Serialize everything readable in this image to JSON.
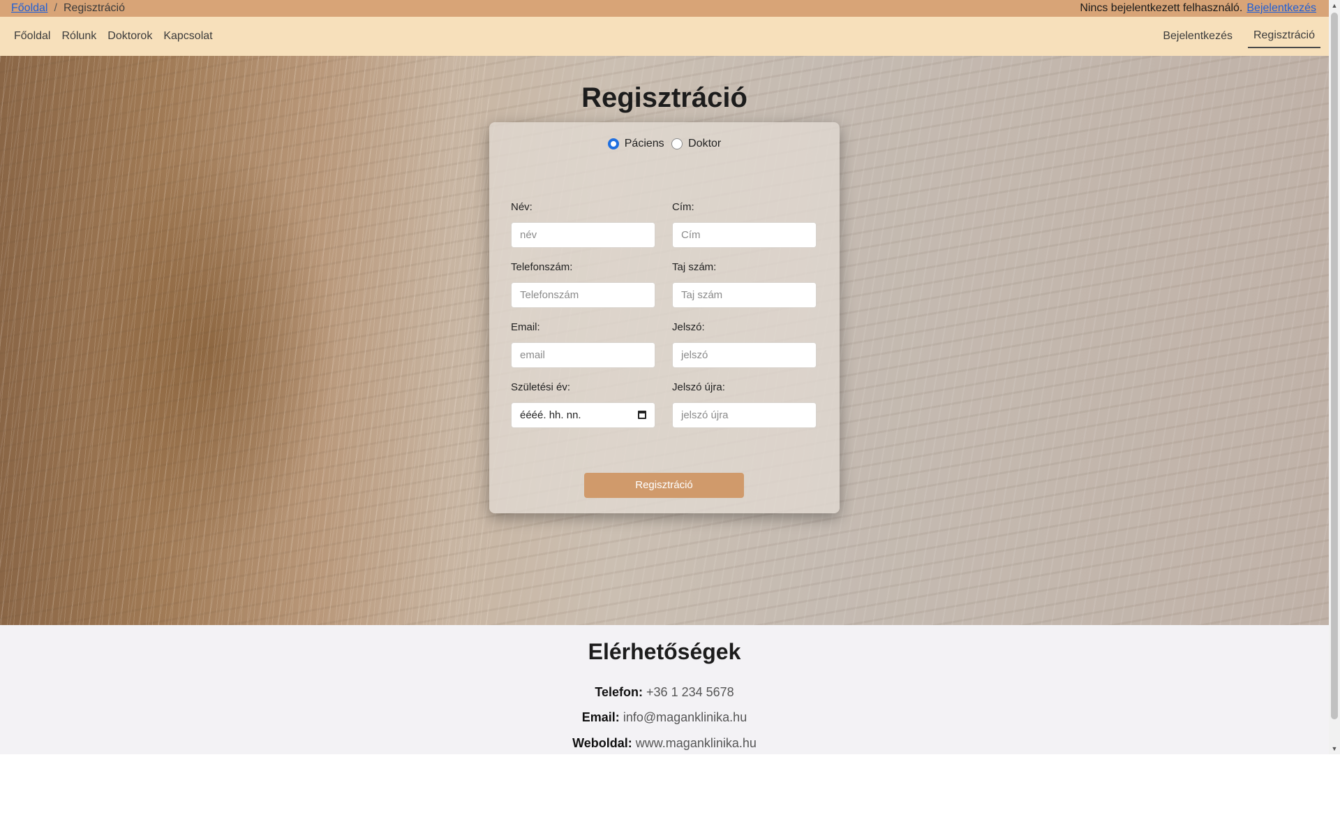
{
  "breadcrumb": {
    "home": "Főoldal",
    "separator": "/",
    "current": "Regisztráció"
  },
  "user_status": {
    "text": "Nincs bejelentkezett felhasználó.",
    "login_link": "Bejelentkezés"
  },
  "nav": {
    "left": [
      "Főoldal",
      "Rólunk",
      "Doktorok",
      "Kapcsolat"
    ],
    "right": [
      "Bejelentkezés",
      "Regisztráció"
    ]
  },
  "form": {
    "title": "Regisztráció",
    "roles": [
      "Páciens",
      "Doktor"
    ],
    "selected_role": "Páciens",
    "fields": {
      "name": {
        "label": "Név:",
        "placeholder": "név"
      },
      "address": {
        "label": "Cím:",
        "placeholder": "Cím"
      },
      "phone": {
        "label": "Telefonszám:",
        "placeholder": "Telefonszám"
      },
      "taj": {
        "label": "Taj szám:",
        "placeholder": "Taj szám"
      },
      "email": {
        "label": "Email:",
        "placeholder": "email"
      },
      "password": {
        "label": "Jelszó:",
        "placeholder": "jelszó"
      },
      "birth": {
        "label": "Születési év:",
        "value": "éééé. hh. nn."
      },
      "password2": {
        "label": "Jelszó újra:",
        "placeholder": "jelszó újra"
      }
    },
    "submit": "Regisztráció"
  },
  "contacts": {
    "title": "Elérhetőségek",
    "phone_label": "Telefon:",
    "phone": "+36 1 234 5678",
    "email_label": "Email:",
    "email": "info@maganklinika.hu",
    "web_label": "Weboldal:",
    "web": "www.maganklinika.hu"
  },
  "colors": {
    "topbar": "#d8a477",
    "navbar": "#f7e0bb",
    "accent": "#d09a6b",
    "link": "#1f5fd6",
    "radio": "#1f6fe0"
  }
}
